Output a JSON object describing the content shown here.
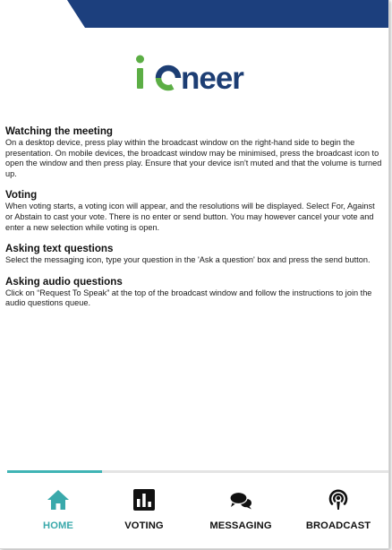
{
  "app": {
    "logo_text": "ioneer"
  },
  "colors": {
    "navy": "#1c3f7d",
    "teal": "#40b4b5",
    "logo_green": "#5cae45",
    "logo_dark": "#1d3e74"
  },
  "sections": [
    {
      "heading": "Watching the meeting",
      "body": "On a desktop device, press play within the broadcast window on the right-hand side to begin the presentation. On mobile devices, the broadcast window may be minimised, press the broadcast icon to open the window and then press play. Ensure that your device isn't muted and that the volume is turned up."
    },
    {
      "heading": "Voting",
      "body": "When voting starts, a voting icon will appear, and the resolutions will be displayed. Select For, Against or Abstain to cast your vote. There is no enter or send button. You may however cancel your vote and enter a new selection while voting is open."
    },
    {
      "heading": "Asking text questions",
      "body": "Select the messaging icon, type your question in the 'Ask a question' box and press the send button."
    },
    {
      "heading": "Asking audio questions",
      "body": "Click on “Request To Speak” at the top of the broadcast window and follow the instructions to join the audio questions queue."
    }
  ],
  "tabs": [
    {
      "label": "HOME",
      "icon": "home-icon",
      "active": true
    },
    {
      "label": "VOTING",
      "icon": "bar-chart-icon",
      "active": false
    },
    {
      "label": "MESSAGING",
      "icon": "chat-bubbles-icon",
      "active": false
    },
    {
      "label": "BROADCAST",
      "icon": "podcast-icon",
      "active": false
    }
  ]
}
